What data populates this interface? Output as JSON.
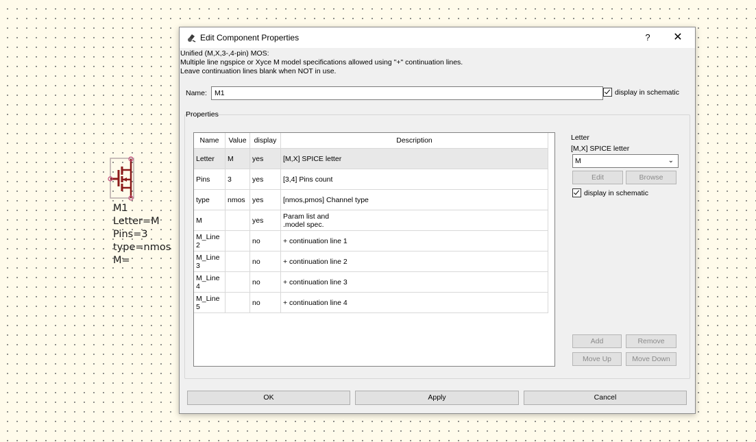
{
  "schematic": {
    "labels": [
      "M1",
      "Letter=M",
      "Pins=3",
      "type=nmos",
      "M="
    ]
  },
  "dialog": {
    "title": "Edit Component Properties",
    "help_label": "?",
    "close_label": "✕",
    "description": [
      "Unified (M,X,3-,4-pin) MOS:",
      "Multiple line ngspice or Xyce M model specifications allowed using \"+\" continuation lines.",
      "Leave continuation lines blank when NOT in use."
    ],
    "name_label": "Name:",
    "name_value": "M1",
    "display_in_schematic_label": "display in schematic",
    "properties_label": "Properties",
    "table": {
      "headers": [
        "Name",
        "Value",
        "display",
        "Description"
      ],
      "rows": [
        {
          "name": "Letter",
          "value": "M",
          "display": "yes",
          "description": "[M,X] SPICE letter"
        },
        {
          "name": "Pins",
          "value": "3",
          "display": "yes",
          "description": "[3,4] Pins count"
        },
        {
          "name": "type",
          "value": "nmos",
          "display": "yes",
          "description": "[nmos,pmos] Channel type"
        },
        {
          "name": "M",
          "value": "",
          "display": "yes",
          "description": "Param list and\n .model spec."
        },
        {
          "name": "M_Line 2",
          "value": "",
          "display": "no",
          "description": "+ continuation line 1"
        },
        {
          "name": "M_Line 3",
          "value": "",
          "display": "no",
          "description": "+ continuation line 2"
        },
        {
          "name": "M_Line 4",
          "value": "",
          "display": "no",
          "description": "+ continuation line 3"
        },
        {
          "name": "M_Line 5",
          "value": "",
          "display": "no",
          "description": "+ continuation line 4"
        }
      ]
    },
    "side": {
      "title": "Letter",
      "subtitle": "[M,X] SPICE letter",
      "selected_value": "M",
      "edit_label": "Edit",
      "browse_label": "Browse",
      "display_label": "display in schematic",
      "add_label": "Add",
      "remove_label": "Remove",
      "move_up_label": "Move Up",
      "move_down_label": "Move Down"
    },
    "footer": {
      "ok_label": "OK",
      "apply_label": "Apply",
      "cancel_label": "Cancel"
    }
  },
  "colors": {
    "canvas_bg": "#fffbeb",
    "component_red": "#8b1a1a",
    "component_outline": "#b7a9a9"
  }
}
